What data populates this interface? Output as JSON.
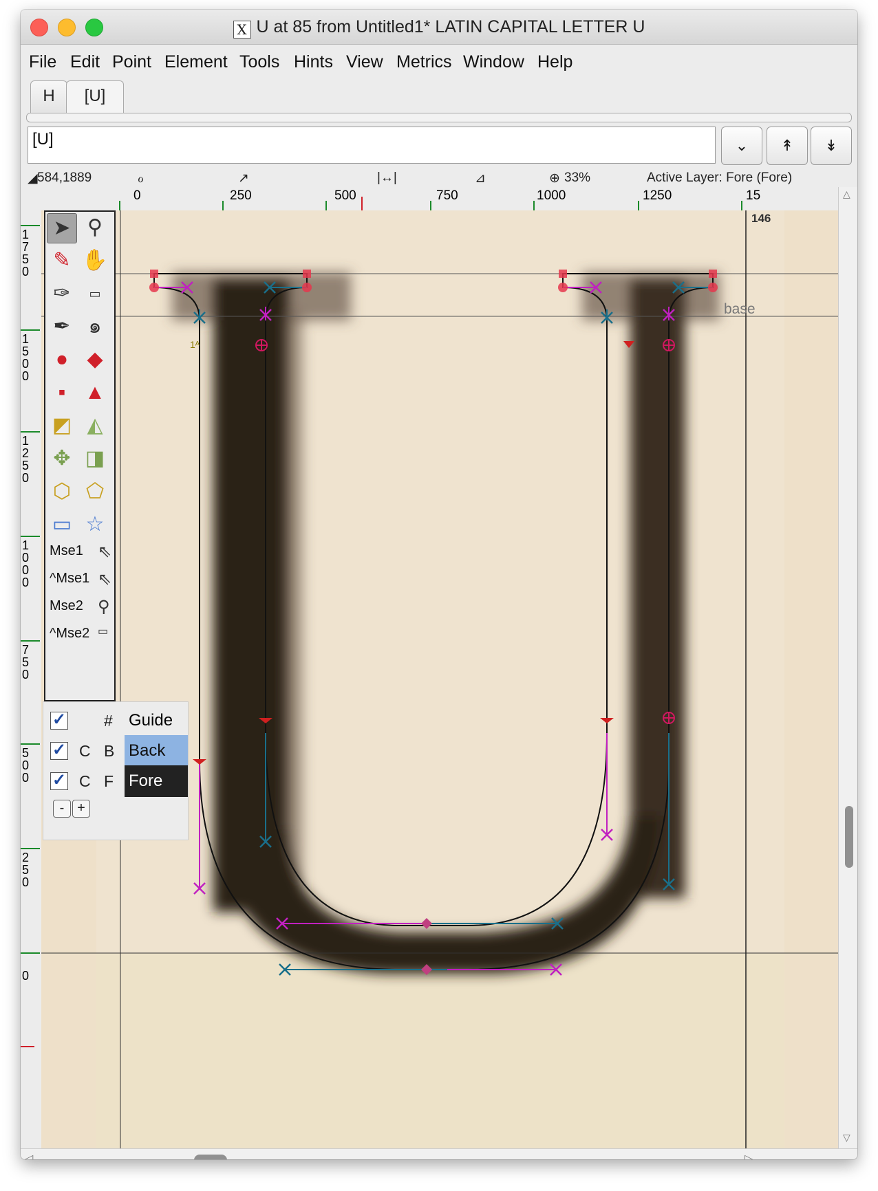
{
  "window": {
    "title": "U at 85 from Untitled1* LATIN CAPITAL LETTER U",
    "x11_icon_glyph": "X"
  },
  "menu": [
    "File",
    "Edit",
    "Point",
    "Element",
    "Tools",
    "Hints",
    "View",
    "Metrics",
    "Window",
    "Help"
  ],
  "tabs": [
    "H",
    "[U]"
  ],
  "char_input": {
    "value": "[U]"
  },
  "buttons": {
    "dropdown": "⌄",
    "up": "↟",
    "down": "↡"
  },
  "status": {
    "coords": "584,1889",
    "zoom": "33%",
    "active_layer": "Active Layer: Fore (Fore)"
  },
  "ruler_top": [
    "0",
    "250",
    "500",
    "750",
    "1000",
    "1250",
    "15"
  ],
  "ruler_left": [
    "1750",
    "1500",
    "1250",
    "1000",
    "750",
    "500",
    "250",
    "0"
  ],
  "canvas": {
    "advance_label": "146",
    "baseline_label": "base"
  },
  "tools": {
    "mouse_labels": [
      "Mse1",
      "^Mse1",
      "Mse2",
      "^Mse2"
    ]
  },
  "layers": {
    "guide": {
      "c": "",
      "f": "#",
      "name": "Guide",
      "checked": true
    },
    "back": {
      "c": "C",
      "f": "B",
      "name": "Back",
      "checked": true
    },
    "fore": {
      "c": "C",
      "f": "F",
      "name": "Fore",
      "checked": true
    },
    "minus": "-",
    "plus": "+"
  },
  "colors": {
    "accent_back": "#8db3e2",
    "fore_bg": "#222222",
    "ruler_green": "#1a8a2a",
    "ruler_red": "#d0202a",
    "control_magenta": "#c020c0",
    "control_teal": "#1a6f8a",
    "point_red": "#e5384e"
  }
}
